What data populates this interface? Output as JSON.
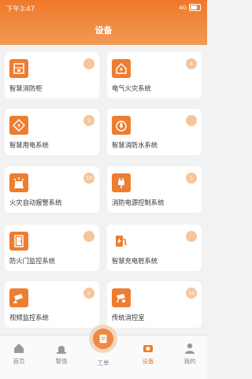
{
  "status_bar": {
    "time": "下午3:47",
    "signal": "4G",
    "battery": "■"
  },
  "header": {
    "title": "设备"
  },
  "cards": [
    {
      "label": "智慧消防柜",
      "badge": "",
      "icon": "fire-cabinet-icon"
    },
    {
      "label": "电气火灾系统",
      "badge": "4",
      "icon": "electric-house-icon"
    },
    {
      "label": "智慧用电系统",
      "badge": "2",
      "icon": "lightning-icon"
    },
    {
      "label": "智慧消防水系统",
      "badge": "",
      "icon": "water-drop-icon"
    },
    {
      "label": "火灾自动报警系统",
      "badge": "10",
      "icon": "alarm-light-icon"
    },
    {
      "label": "消防电源控制系统",
      "badge": "5",
      "icon": "power-plug-icon"
    },
    {
      "label": "防火门监控系统",
      "badge": "",
      "icon": "fire-door-icon"
    },
    {
      "label": "智慧充电桩系统",
      "badge": "",
      "icon": "charging-pile-icon"
    },
    {
      "label": "视频监控系统",
      "badge": "2",
      "icon": "camera-icon"
    },
    {
      "label": "传统消控室",
      "badge": "16",
      "icon": "control-room-icon"
    }
  ],
  "nav": {
    "home": "首页",
    "alarm": "警情",
    "workorder": "工单",
    "device": "设备",
    "mine": "我的"
  },
  "colors": {
    "accent": "#ed7d31",
    "badge": "#f6c59c"
  }
}
